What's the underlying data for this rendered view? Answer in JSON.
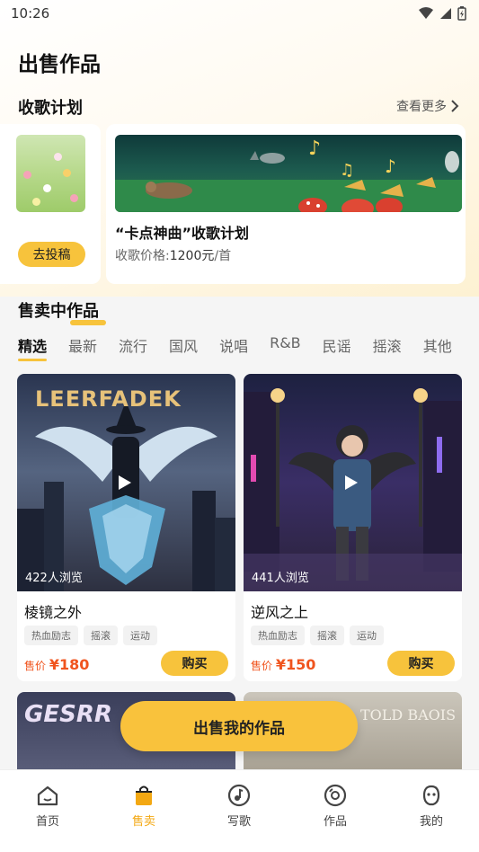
{
  "status_bar": {
    "time": "10:26"
  },
  "page_title": "出售作品",
  "collect_section": {
    "title": "收歌计划",
    "more_label": "查看更多",
    "left_card": {
      "button_label": "去投稿"
    },
    "main_card": {
      "title": "“卡点神曲”收歌计划",
      "price_label": "收歌价格:",
      "price_value": "1200元",
      "price_unit": "/首"
    }
  },
  "selling_section": {
    "title": "售卖中作品",
    "tabs": [
      "精选",
      "最新",
      "流行",
      "国风",
      "说唱",
      "R&B",
      "民谣",
      "摇滚",
      "其他"
    ],
    "active_tab": "精选"
  },
  "works": [
    {
      "cover_text": "LEERFADEK",
      "views": "422人浏览",
      "title": "棱镜之外",
      "tags": [
        "热血励志",
        "摇滚",
        "运动"
      ],
      "price_label": "售价",
      "price": "¥180",
      "buy_label": "购买"
    },
    {
      "cover_text": "",
      "views": "441人浏览",
      "title": "逆风之上",
      "tags": [
        "热血励志",
        "摇滚",
        "运动"
      ],
      "price_label": "售价",
      "price": "¥150",
      "buy_label": "购买"
    }
  ],
  "partial_works": [
    {
      "cover_text": "GESRR"
    },
    {
      "cover_text": "TOLD BAOIS"
    }
  ],
  "sell_button_label": "出售我的作品",
  "bottom_nav": [
    {
      "label": "首页",
      "icon": "home-icon"
    },
    {
      "label": "售卖",
      "icon": "shopping-bag-icon",
      "active": true
    },
    {
      "label": "写歌",
      "icon": "music-note-icon"
    },
    {
      "label": "作品",
      "icon": "disc-icon"
    },
    {
      "label": "我的",
      "icon": "profile-icon"
    }
  ],
  "colors": {
    "accent": "#f7c33c",
    "price": "#f0541e",
    "active_nav": "#f3a813"
  }
}
